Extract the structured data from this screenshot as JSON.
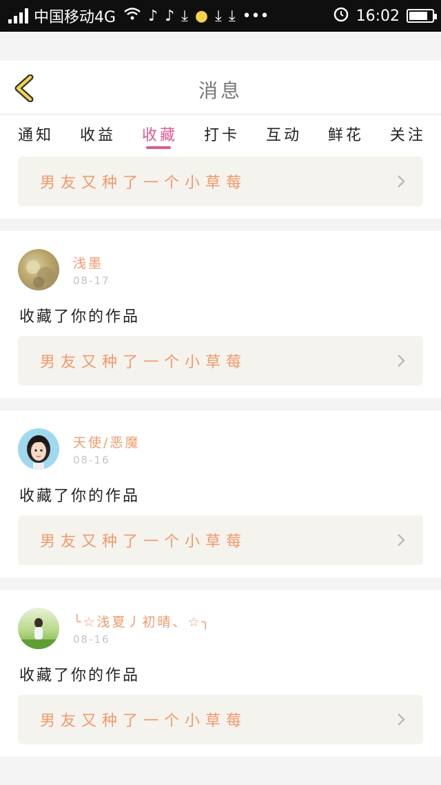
{
  "status_bar": {
    "carrier": "中国移动4G",
    "time": "16:02",
    "icons": [
      "signal-icon",
      "wifi-icon",
      "tiktok-icon",
      "tiktok-icon",
      "download-icon",
      "bulb-icon",
      "download-icon",
      "download-icon",
      "more-dots-icon",
      "alarm-icon",
      "battery-icon"
    ],
    "battery_level": 0.8
  },
  "header": {
    "title": "消息",
    "back_icon": "chevron-left-icon"
  },
  "tabs": [
    {
      "label": "通知",
      "active": false
    },
    {
      "label": "收益",
      "active": false
    },
    {
      "label": "收藏",
      "active": true
    },
    {
      "label": "打卡",
      "active": false
    },
    {
      "label": "互动",
      "active": false
    },
    {
      "label": "鲜花",
      "active": false
    },
    {
      "label": "关注",
      "active": false
    }
  ],
  "colors": {
    "accent": "#e05a94",
    "name_color": "#f29a6a",
    "link_bg": "#f4f3ee",
    "page_bg": "#f4f4f4"
  },
  "feed": {
    "partial_item": {
      "work_title": "男友又种了一个小草莓"
    },
    "items": [
      {
        "username": "浅墨",
        "date": "08-17",
        "action": "收藏了你的作品",
        "work_title": "男友又种了一个小草莓"
      },
      {
        "username": "天使/恶魔",
        "date": "08-16",
        "action": "收藏了你的作品",
        "work_title": "男友又种了一个小草莓"
      },
      {
        "username": "╰☆浅夏丿初晴、☆╮",
        "date": "08-16",
        "action": "收藏了你的作品",
        "work_title": "男友又种了一个小草莓"
      }
    ]
  }
}
